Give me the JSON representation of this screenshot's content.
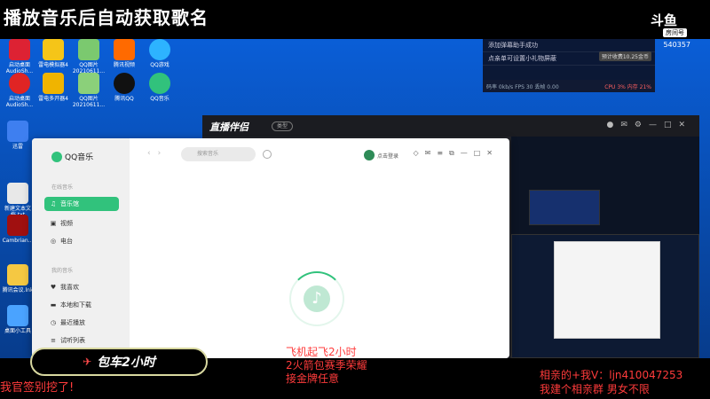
{
  "banner": {
    "title": "播放音乐后自动获取歌名",
    "platform_logo": "斗鱼",
    "platform_badge": "房间号",
    "room_id": "540357"
  },
  "notification": {
    "row1": "添加弹幕助手成功",
    "row2": "点亲单可设置小礼物屏蔽",
    "tag": "预计收费10.25金币"
  },
  "stats": {
    "text": "码率 0kb/s  FPS 30  丢帧 0.00",
    "cpu": "CPU 3% 内存 21%"
  },
  "desktop_icons": [
    {
      "label": "启动桌面 AudioSh..."
    },
    {
      "label": "雷电模拟器4"
    },
    {
      "label": "QQ图片 20210611..."
    },
    {
      "label": "腾讯视频"
    },
    {
      "label": "QQ游戏"
    },
    {
      "label": "启动桌面 AudioSh..."
    },
    {
      "label": "雷电多开器4"
    },
    {
      "label": "QQ图片 20210611..."
    },
    {
      "label": "腾讯QQ"
    },
    {
      "label": "QQ音乐"
    },
    {
      "label": "迅雷"
    },
    {
      "label": "新建文本文档.txt"
    },
    {
      "label": "Cambrian..."
    },
    {
      "label": "腾讯会议.lnk"
    },
    {
      "label": "桌面小工具"
    }
  ],
  "zhibo": {
    "logo": "直播伴侣",
    "pill": "类型"
  },
  "qqmusic": {
    "brand": "QQ音乐",
    "section_online": "在线音乐",
    "section_mine": "我的音乐",
    "items": [
      {
        "icon": "music-note-icon",
        "glyph": "♫",
        "label": "音乐馆",
        "active": true
      },
      {
        "icon": "video-icon",
        "glyph": "▣",
        "label": "视频",
        "active": false
      },
      {
        "icon": "radio-icon",
        "glyph": "◎",
        "label": "电台",
        "active": false
      },
      {
        "icon": "heart-icon",
        "glyph": "♥",
        "label": "我喜欢",
        "active": false
      },
      {
        "icon": "monitor-icon",
        "glyph": "▬",
        "label": "本地和下载",
        "active": false
      },
      {
        "icon": "clock-icon",
        "glyph": "◷",
        "label": "最近播放",
        "active": false
      },
      {
        "icon": "list-icon",
        "glyph": "≡",
        "label": "试听列表",
        "active": false
      }
    ],
    "search_placeholder": "搜索音乐",
    "login_label": "点击登录"
  },
  "overlay": {
    "left_bottom": "我官签别挖了!",
    "center_lines": [
      "飞机起飞2小时",
      "2火箭包赛季荣耀",
      "接金牌任意"
    ],
    "right_lines": [
      "相亲的+我V：ljn410047253",
      "我建个相亲群 男女不限"
    ],
    "car_button": "包车2小时"
  },
  "colors": {
    "accent_green": "#31c27c",
    "overlay_red": "#ff3b3b",
    "desktop_blue": "#0a57c2"
  }
}
